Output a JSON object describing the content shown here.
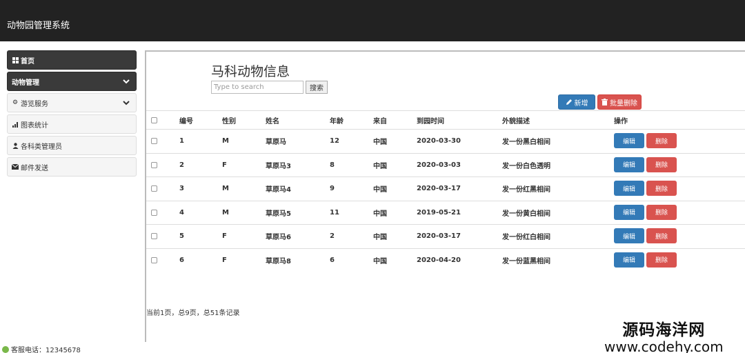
{
  "app": {
    "title": "动物园管理系统"
  },
  "sidebar": {
    "items": [
      {
        "label": "首页",
        "icon": "grid-icon"
      },
      {
        "label": "动物管理",
        "icon": "",
        "chevron": true
      },
      {
        "label": "游览服务",
        "icon": "gear-icon",
        "chevron": true
      },
      {
        "label": "图表统计",
        "icon": "bar-chart-icon"
      },
      {
        "label": "各科类管理员",
        "icon": "user-icon"
      },
      {
        "label": "邮件发送",
        "icon": "envelope-icon"
      }
    ]
  },
  "main": {
    "title": "马科动物信息",
    "search": {
      "placeholder": "Type to search",
      "value": "",
      "button": "搜索"
    },
    "toolbar": {
      "add_label": "新增",
      "batch_delete_label": "批量删除"
    },
    "table": {
      "headers": [
        "编号",
        "性别",
        "姓名",
        "年龄",
        "来自",
        "到园时间",
        "外貌描述",
        "操作"
      ],
      "rows": [
        {
          "id": "1",
          "sex": "M",
          "name": "草原马",
          "age": "12",
          "from": "中国",
          "date": "2020-03-30",
          "desc": "发一份黑白相间"
        },
        {
          "id": "2",
          "sex": "F",
          "name": "草原马3",
          "age": "8",
          "from": "中国",
          "date": "2020-03-03",
          "desc": "发一份白色透明"
        },
        {
          "id": "3",
          "sex": "M",
          "name": "草原马4",
          "age": "9",
          "from": "中国",
          "date": "2020-03-17",
          "desc": "发一份红黑相间"
        },
        {
          "id": "4",
          "sex": "M",
          "name": "草原马5",
          "age": "11",
          "from": "中国",
          "date": "2019-05-21",
          "desc": "发一份黄白相间"
        },
        {
          "id": "5",
          "sex": "F",
          "name": "草原马6",
          "age": "2",
          "from": "中国",
          "date": "2020-03-17",
          "desc": "发一份红白相间"
        },
        {
          "id": "6",
          "sex": "F",
          "name": "草原马8",
          "age": "6",
          "from": "中国",
          "date": "2020-04-20",
          "desc": "发一份蓝黑相间"
        }
      ],
      "edit_label": "编辑",
      "delete_label": "删除"
    },
    "pagination": "当前1页，总9页，总51条记录"
  },
  "footer": {
    "phone_label": "客服电话：12345678"
  },
  "watermark": {
    "line1": "源码海洋网",
    "line2": "www.codehy.com"
  },
  "colors": {
    "navbar": "#222222",
    "primary": "#337ab7",
    "danger": "#d9534f",
    "sidebar_active": "#3a3a3a"
  }
}
